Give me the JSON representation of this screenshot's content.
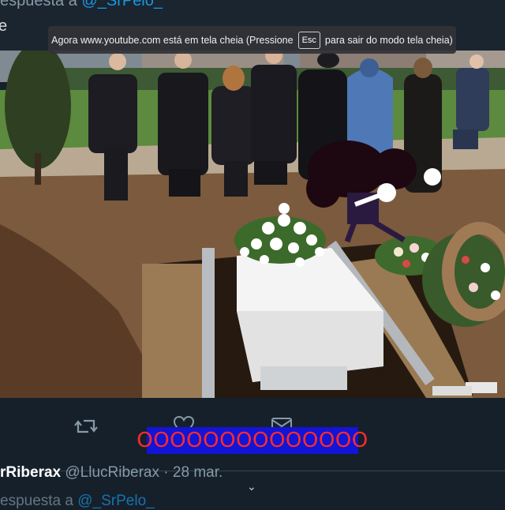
{
  "tweet_top": {
    "reply_prefix": "espuesta a",
    "reply_handle": "@_SrPelo_",
    "stray_char": "e"
  },
  "fullscreen_banner": {
    "text_before": "Agora www.youtube.com está em tela cheia (Pressione",
    "key": "Esc",
    "text_after": "para sair do modo tela cheia)"
  },
  "photo": {
    "description_icon": "funeral-photo-with-dancing-pallbearer-sticker"
  },
  "tweet_actions": {
    "retweet_icon": "retweet-icon",
    "like_icon": "heart-icon",
    "share_icon": "share-icon"
  },
  "overlay_text": "OOOOOOOOOOOOOO",
  "tweet_bottom": {
    "author_name": "rRiberax",
    "author_handle": "@LlucRiberax",
    "separator": "·",
    "date": "28 mar.",
    "reply_prefix": "espuesta a",
    "reply_handle": "@_SrPelo_"
  },
  "colors": {
    "background": "#15202b",
    "link": "#1b95e0",
    "muted": "#8899a6",
    "overlay_box": "#1214d6",
    "overlay_text": "#ff2a2a"
  }
}
